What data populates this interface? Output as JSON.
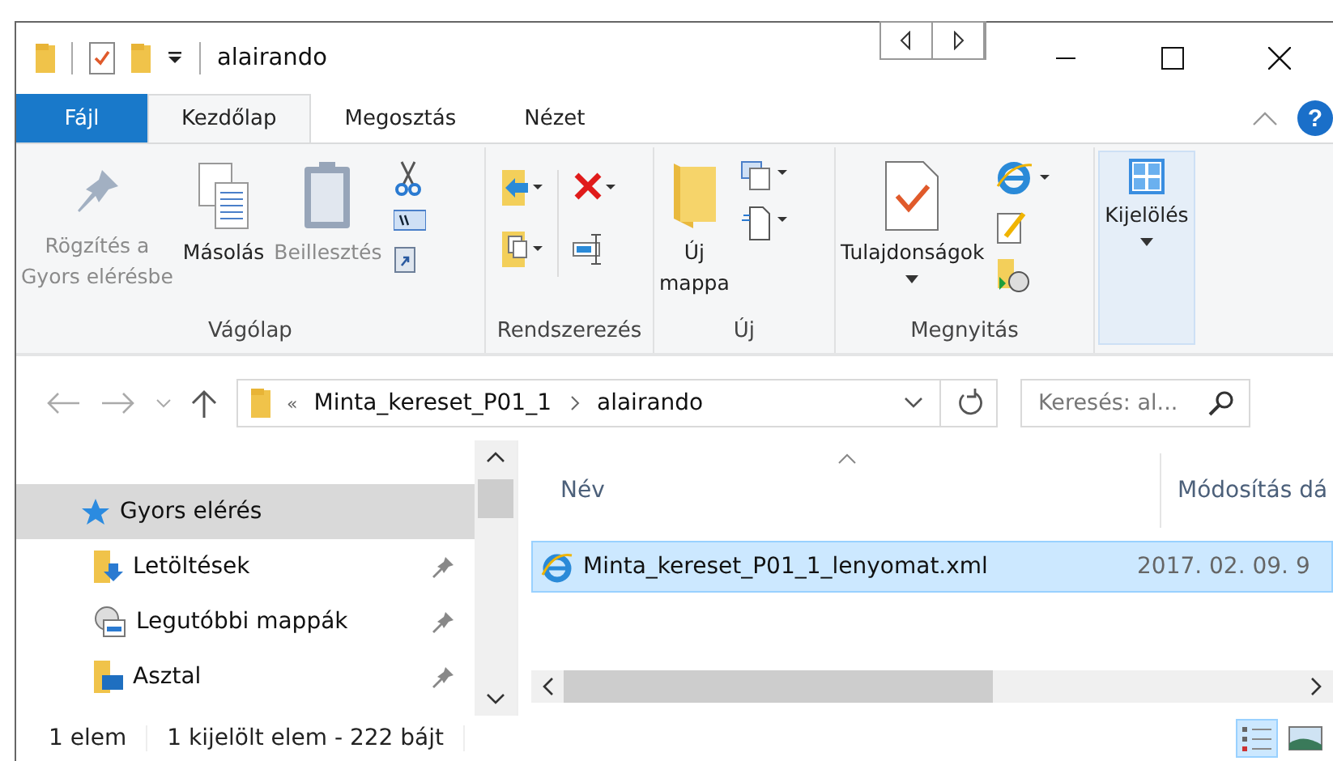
{
  "window": {
    "title": "alairando"
  },
  "tabs": [
    {
      "label": "Fájl",
      "kind": "file",
      "selected": false
    },
    {
      "label": "Kezdőlap",
      "kind": "tab",
      "selected": true
    },
    {
      "label": "Megosztás",
      "kind": "tab",
      "selected": false
    },
    {
      "label": "Nézet",
      "kind": "tab",
      "selected": false
    }
  ],
  "ribbon": [
    {
      "label": "Vágólap",
      "buttons": [
        {
          "label": "Rögzítés a\nGyors elérésbe",
          "disabled": true
        },
        {
          "label": "Másolás",
          "disabled": false
        },
        {
          "label": "Beillesztés",
          "disabled": true
        }
      ]
    },
    {
      "label": "Rendszerezés"
    },
    {
      "label": "Új",
      "buttons": [
        {
          "label": "Új\nmappa",
          "disabled": false
        }
      ]
    },
    {
      "label": "Megnyitás",
      "buttons": [
        {
          "label": "Tulajdonságok",
          "disabled": false
        }
      ]
    },
    {
      "buttons": [
        {
          "label": "Kijelölés",
          "disabled": false,
          "selected": true
        }
      ]
    }
  ],
  "help": {
    "label": "?"
  },
  "address": {
    "path": [
      "«",
      "Minta_kereset_P01_1",
      "alairando"
    ]
  },
  "search": {
    "placeholder": "Keresés: al..."
  },
  "nav": [
    {
      "label": "Gyors elérés",
      "selected": true,
      "pinned": false
    },
    {
      "label": "Letöltések",
      "selected": false,
      "pinned": true
    },
    {
      "label": "Legutóbbi mappák",
      "selected": false,
      "pinned": true
    },
    {
      "label": "Asztal",
      "selected": false,
      "pinned": true
    }
  ],
  "columns": [
    "Név",
    "Módosítás dá"
  ],
  "files": [
    {
      "name": "Minta_kereset_P01_1_lenyomat.xml",
      "date": "2017. 02. 09. 9",
      "selected": true
    }
  ],
  "status_bar": [
    "1 elem",
    "1 kijelölt elem - 222 bájt"
  ],
  "views": [
    {
      "selected": true
    },
    {
      "selected": false
    }
  ]
}
